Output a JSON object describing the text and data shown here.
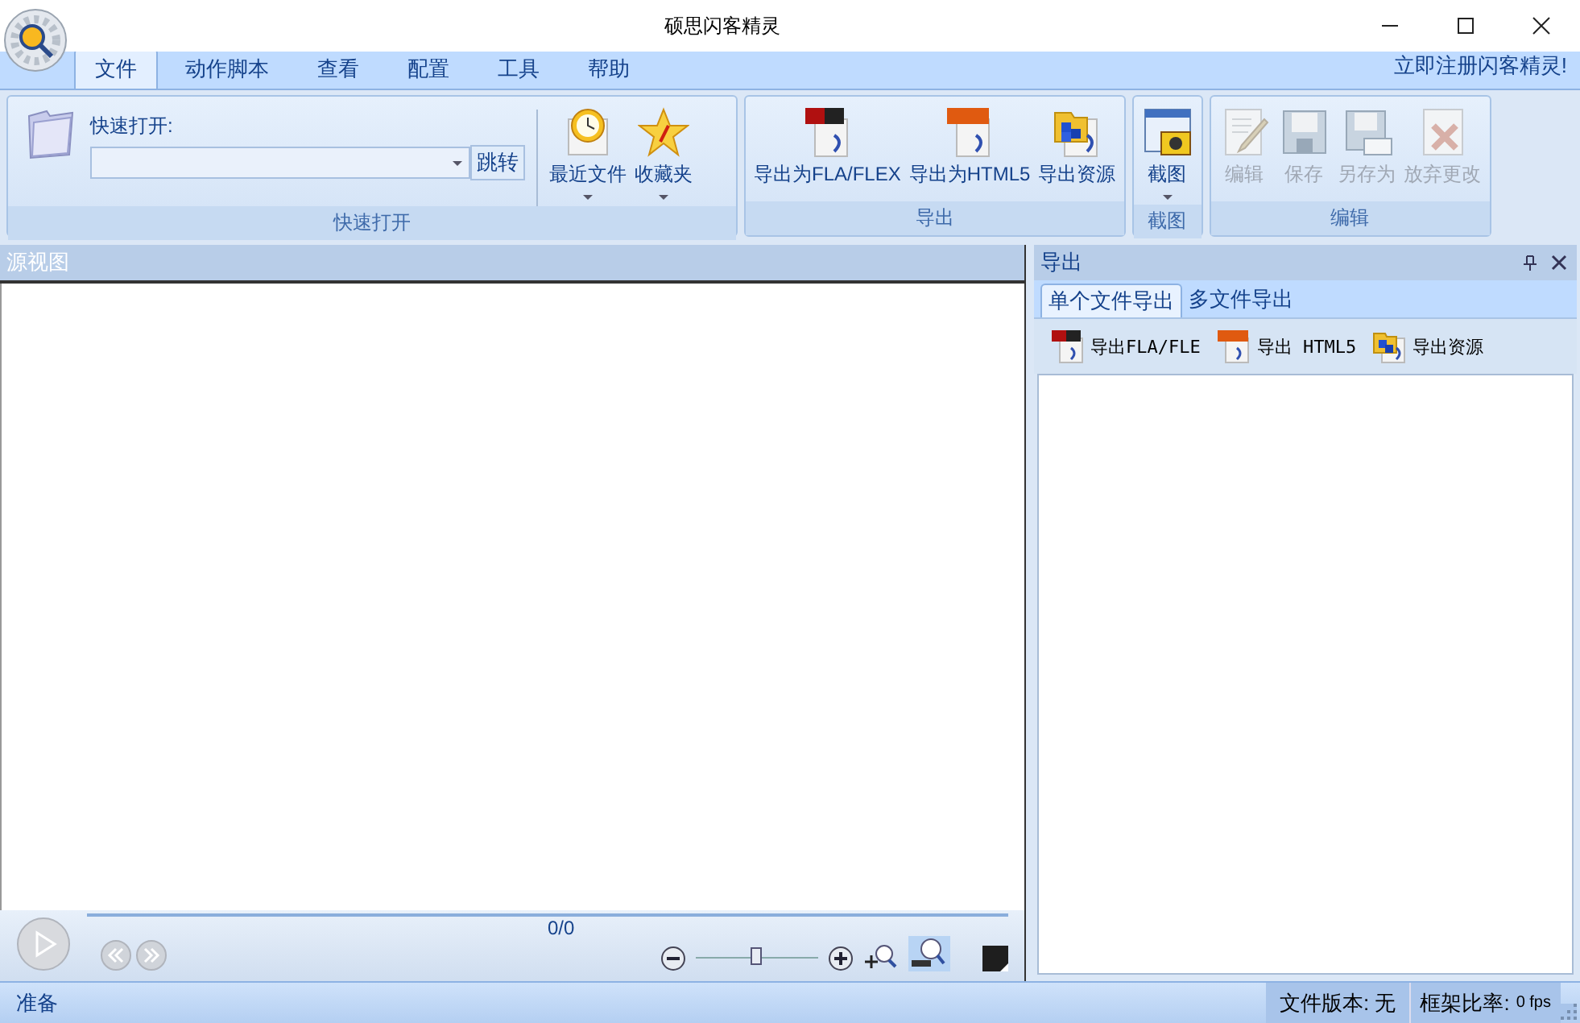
{
  "window": {
    "title": "硕思闪客精灵"
  },
  "menu_tabs": [
    {
      "label": "文件",
      "selected": true
    },
    {
      "label": "动作脚本",
      "selected": false
    },
    {
      "label": "查看",
      "selected": false
    },
    {
      "label": "配置",
      "selected": false
    },
    {
      "label": "工具",
      "selected": false
    },
    {
      "label": "帮助",
      "selected": false
    }
  ],
  "register_link": "立即注册闪客精灵!",
  "ribbon_groups": [
    {
      "label": "快速打开",
      "quick_open": {
        "label": "快速打开:",
        "button": "跳转"
      },
      "buttons": [
        {
          "label": "最近文件",
          "kind": "recent",
          "dropdown": true,
          "disabled": false
        },
        {
          "label": "收藏夹",
          "kind": "favorites",
          "dropdown": true,
          "disabled": false
        }
      ]
    },
    {
      "label": "导出",
      "buttons": [
        {
          "label": "导出为FLA/FLEX",
          "kind": "fla",
          "dropdown": false,
          "disabled": false
        },
        {
          "label": "导出为HTML5",
          "kind": "html5",
          "dropdown": false,
          "disabled": false
        },
        {
          "label": "导出资源",
          "kind": "resource",
          "dropdown": false,
          "disabled": false
        }
      ]
    },
    {
      "label": "截图",
      "buttons": [
        {
          "label": "截图",
          "kind": "capture",
          "dropdown": true,
          "disabled": false
        }
      ]
    },
    {
      "label": "编辑",
      "buttons": [
        {
          "label": "编辑",
          "kind": "edit",
          "dropdown": false,
          "disabled": true
        },
        {
          "label": "保存",
          "kind": "save",
          "dropdown": false,
          "disabled": true
        },
        {
          "label": "另存为",
          "kind": "saveas",
          "dropdown": false,
          "disabled": true
        },
        {
          "label": "放弃更改",
          "kind": "discard",
          "dropdown": false,
          "disabled": true
        }
      ]
    }
  ],
  "source_view": {
    "title": "源视图",
    "frame_counter": "0/0",
    "zoom": {
      "level": 0.45
    }
  },
  "export_panel": {
    "title": "导出",
    "tabs": [
      {
        "label": "单个文件导出",
        "selected": true
      },
      {
        "label": "多文件导出",
        "selected": false
      }
    ],
    "buttons": [
      {
        "label": "导出FLA/FLE",
        "kind": "fla"
      },
      {
        "label": "导出 HTML5",
        "kind": "html5"
      },
      {
        "label": "导出资源",
        "kind": "resource"
      }
    ]
  },
  "status_bar": {
    "status": "准备",
    "file_version": "文件版本: 无",
    "frame_rate_label": "框架比率:",
    "frame_rate": "0 fps"
  }
}
